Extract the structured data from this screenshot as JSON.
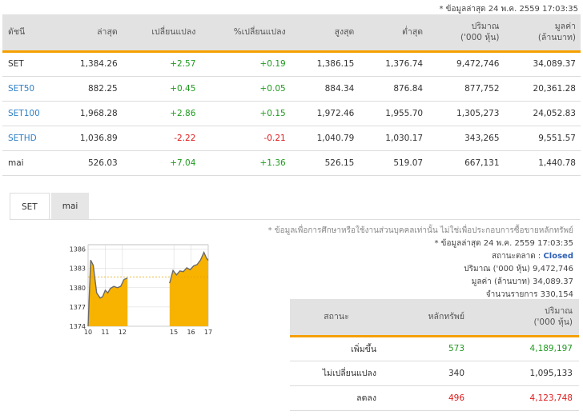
{
  "last_update_note": "* ข้อมูลล่าสุด 24 พ.ค. 2559 17:03:35",
  "index_table": {
    "headers": {
      "name": "ดัชนี",
      "last": "ล่าสุด",
      "change": "เปลี่ยนแปลง",
      "pct_change": "%เปลี่ยนแปลง",
      "high": "สูงสุด",
      "low": "ต่ำสุด",
      "volume_line1": "ปริมาณ",
      "volume_line2": "('000 หุ้น)",
      "value_line1": "มูลค่า",
      "value_line2": "(ล้านบาท)"
    },
    "rows": [
      {
        "name": "SET",
        "last": "1,384.26",
        "change": "+2.57",
        "pct": "+0.19",
        "high": "1,386.15",
        "low": "1,376.74",
        "volume": "9,472,746",
        "value": "34,089.37",
        "dir": "up",
        "is_link": false
      },
      {
        "name": "SET50",
        "last": "882.25",
        "change": "+0.45",
        "pct": "+0.05",
        "high": "884.34",
        "low": "876.84",
        "volume": "877,752",
        "value": "20,361.28",
        "dir": "up",
        "is_link": true
      },
      {
        "name": "SET100",
        "last": "1,968.28",
        "change": "+2.86",
        "pct": "+0.15",
        "high": "1,972.46",
        "low": "1,955.70",
        "volume": "1,305,273",
        "value": "24,052.83",
        "dir": "up",
        "is_link": true
      },
      {
        "name": "SETHD",
        "last": "1,036.89",
        "change": "-2.22",
        "pct": "-0.21",
        "high": "1,040.79",
        "low": "1,030.17",
        "volume": "343,265",
        "value": "9,551.57",
        "dir": "down",
        "is_link": true
      },
      {
        "name": "mai",
        "last": "526.03",
        "change": "+7.04",
        "pct": "+1.36",
        "high": "526.15",
        "low": "519.07",
        "volume": "667,131",
        "value": "1,440.78",
        "dir": "up",
        "is_link": false
      }
    ]
  },
  "tabs": [
    "SET",
    "mai"
  ],
  "chart_data": {
    "type": "area",
    "title": "",
    "xlabel": "",
    "ylabel": "",
    "x_ticks": [
      "10",
      "11",
      "12",
      "15",
      "16",
      "17"
    ],
    "y_ticks": [
      1374,
      1377,
      1380,
      1383,
      1386
    ],
    "ylim": [
      1374,
      1386.7
    ],
    "xlim": [
      10,
      17
    ],
    "session_gap": [
      12.3,
      14.75
    ],
    "previous_close": 1381.69,
    "series": [
      {
        "values": [
          [
            10.0,
            1374.0
          ],
          [
            10.15,
            1384.3
          ],
          [
            10.3,
            1383.5
          ],
          [
            10.5,
            1379.2
          ],
          [
            10.7,
            1378.4
          ],
          [
            10.85,
            1378.6
          ],
          [
            11.0,
            1379.6
          ],
          [
            11.15,
            1379.2
          ],
          [
            11.3,
            1379.9
          ],
          [
            11.5,
            1380.2
          ],
          [
            11.7,
            1380.0
          ],
          [
            11.9,
            1380.2
          ],
          [
            12.1,
            1381.3
          ],
          [
            12.3,
            1381.5
          ],
          [
            14.75,
            1380.7
          ],
          [
            14.95,
            1382.7
          ],
          [
            15.15,
            1382.0
          ],
          [
            15.35,
            1382.6
          ],
          [
            15.55,
            1382.5
          ],
          [
            15.75,
            1383.1
          ],
          [
            15.95,
            1382.8
          ],
          [
            16.15,
            1383.4
          ],
          [
            16.35,
            1383.6
          ],
          [
            16.55,
            1384.3
          ],
          [
            16.75,
            1385.5
          ],
          [
            16.9,
            1384.6
          ],
          [
            17.0,
            1384.26
          ]
        ]
      }
    ],
    "fill_color": "#f7b300",
    "line_color": "#6a6a6a",
    "prev_close_color": "#e8a000",
    "grid": true
  },
  "info": {
    "disclaimer": "* ข้อมูลเพื่อการศึกษาหรือใช้งานส่วนบุคคลเท่านั้น ไม่ใช่เพื่อประกอบการซื้อขายหลักทรัพย์",
    "last_update": "* ข้อมูลล่าสุด 24 พ.ค. 2559 17:03:35",
    "market_status_label": "สถานะตลาด :",
    "market_status_value": "Closed",
    "volume_label": "ปริมาณ ('000 หุ้น)",
    "volume_value": "9,472,746",
    "value_label": "มูลค่า (ล้านบาท)",
    "value_value": "34,089.37",
    "deals_label": "จำนวนรายการ",
    "deals_value": "330,154"
  },
  "stat_table": {
    "headers": {
      "status": "สถานะ",
      "securities": "หลักทรัพย์",
      "volume_line1": "ปริมาณ",
      "volume_line2": "('000 หุ้น)"
    },
    "rows": [
      {
        "label": "เพิ่มขึ้น",
        "count": "573",
        "volume": "4,189,197",
        "dir": "up"
      },
      {
        "label": "ไม่เปลี่ยนแปลง",
        "count": "340",
        "volume": "1,095,133",
        "dir": "flat"
      },
      {
        "label": "ลดลง",
        "count": "496",
        "volume": "4,123,748",
        "dir": "down"
      }
    ]
  }
}
